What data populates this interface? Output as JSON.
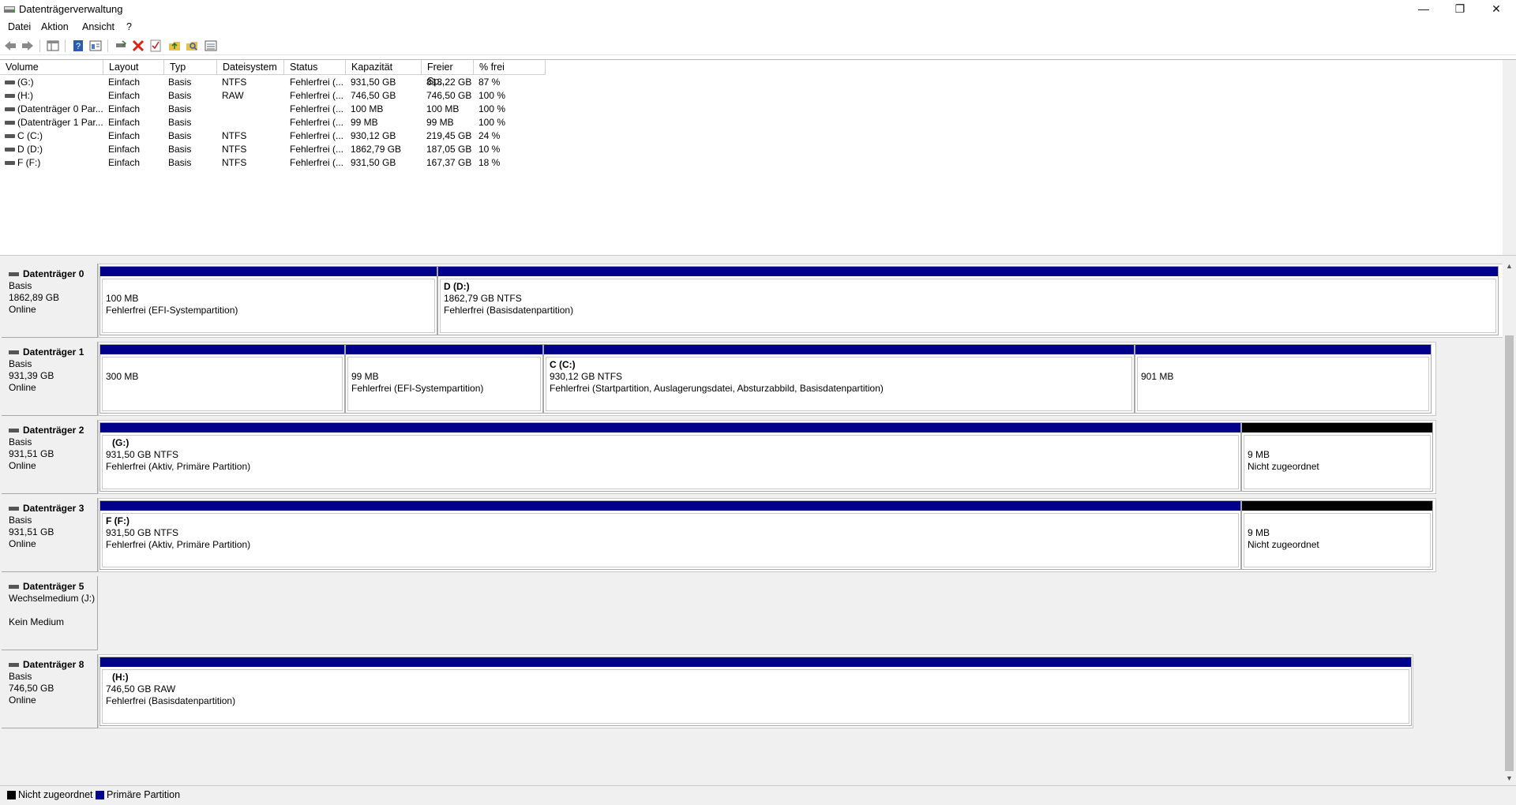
{
  "window": {
    "title": "Datenträgerverwaltung",
    "minimize": "—",
    "maximize": "❐",
    "close": "✕"
  },
  "menu": [
    "Datei",
    "Aktion",
    "Ansicht",
    "?"
  ],
  "toolbar": [
    "back-icon",
    "forward-icon",
    "console-tree-icon",
    "help-icon",
    "properties-icon",
    "connect-icon",
    "delete-icon",
    "check-icon",
    "import-icon",
    "search-icon",
    "list-icon"
  ],
  "columns": [
    "Volume",
    "Layout",
    "Typ",
    "Dateisystem",
    "Status",
    "Kapazität",
    "Freier Sp...",
    "% frei"
  ],
  "volumes": [
    {
      "volume": "(G:)",
      "layout": "Einfach",
      "typ": "Basis",
      "fs": "NTFS",
      "status": "Fehlerfrei (...",
      "cap": "931,50 GB",
      "free": "813,22 GB",
      "pct": "87 %"
    },
    {
      "volume": "(H:)",
      "layout": "Einfach",
      "typ": "Basis",
      "fs": "RAW",
      "status": "Fehlerfrei (...",
      "cap": "746,50 GB",
      "free": "746,50 GB",
      "pct": "100 %"
    },
    {
      "volume": "(Datenträger 0 Par...",
      "layout": "Einfach",
      "typ": "Basis",
      "fs": "",
      "status": "Fehlerfrei (...",
      "cap": "100 MB",
      "free": "100 MB",
      "pct": "100 %"
    },
    {
      "volume": "(Datenträger 1 Par...",
      "layout": "Einfach",
      "typ": "Basis",
      "fs": "",
      "status": "Fehlerfrei (...",
      "cap": "99 MB",
      "free": "99 MB",
      "pct": "100 %"
    },
    {
      "volume": "C (C:)",
      "layout": "Einfach",
      "typ": "Basis",
      "fs": "NTFS",
      "status": "Fehlerfrei (...",
      "cap": "930,12 GB",
      "free": "219,45 GB",
      "pct": "24 %"
    },
    {
      "volume": "D (D:)",
      "layout": "Einfach",
      "typ": "Basis",
      "fs": "NTFS",
      "status": "Fehlerfrei (...",
      "cap": "1862,79 GB",
      "free": "187,05 GB",
      "pct": "10 %"
    },
    {
      "volume": "F (F:)",
      "layout": "Einfach",
      "typ": "Basis",
      "fs": "NTFS",
      "status": "Fehlerfrei (...",
      "cap": "931,50 GB",
      "free": "167,37 GB",
      "pct": "18 %"
    }
  ],
  "disks": [
    {
      "name": "Datenträger 0",
      "l1": "Basis",
      "l2": "1862,89 GB",
      "l3": "Online",
      "parts": [
        {
          "name": "",
          "l1": "100 MB",
          "l2": "Fehlerfrei (EFI-Systempartition)",
          "bar": "blue"
        },
        {
          "name": "D  (D:)",
          "l1": "1862,79 GB NTFS",
          "l2": "Fehlerfrei (Basisdatenpartition)",
          "bar": "blue"
        }
      ]
    },
    {
      "name": "Datenträger 1",
      "l1": "Basis",
      "l2": "931,39 GB",
      "l3": "Online",
      "parts": [
        {
          "name": "",
          "l1": "300 MB",
          "l2": "",
          "bar": "blue"
        },
        {
          "name": "",
          "l1": "99 MB",
          "l2": "Fehlerfrei (EFI-Systempartition)",
          "bar": "blue"
        },
        {
          "name": "C  (C:)",
          "l1": "930,12 GB NTFS",
          "l2": "Fehlerfrei (Startpartition, Auslagerungsdatei, Absturzabbild, Basisdatenpartition)",
          "bar": "blue"
        },
        {
          "name": "",
          "l1": "901 MB",
          "l2": "",
          "bar": "blue"
        }
      ]
    },
    {
      "name": "Datenträger 2",
      "l1": "Basis",
      "l2": "931,51 GB",
      "l3": "Online",
      "parts": [
        {
          "name": "(G:)",
          "l1": "931,50 GB NTFS",
          "l2": "Fehlerfrei (Aktiv, Primäre Partition)",
          "bar": "blue"
        },
        {
          "name": "",
          "l1": "9 MB",
          "l2": "Nicht zugeordnet",
          "bar": "black"
        }
      ]
    },
    {
      "name": "Datenträger 3",
      "l1": "Basis",
      "l2": "931,51 GB",
      "l3": "Online",
      "parts": [
        {
          "name": "F  (F:)",
          "l1": "931,50 GB NTFS",
          "l2": "Fehlerfrei (Aktiv, Primäre Partition)",
          "bar": "blue"
        },
        {
          "name": "",
          "l1": "9 MB",
          "l2": "Nicht zugeordnet",
          "bar": "black"
        }
      ]
    },
    {
      "name": "Datenträger 5",
      "l1": "Wechselmedium (J:)",
      "l2": "",
      "l3": "Kein Medium",
      "parts": []
    },
    {
      "name": "Datenträger 8",
      "l1": "Basis",
      "l2": "746,50 GB",
      "l3": "Online",
      "parts": [
        {
          "name": "(H:)",
          "l1": "746,50 GB RAW",
          "l2": "Fehlerfrei (Basisdatenpartition)",
          "bar": "blue"
        }
      ]
    }
  ],
  "legend": [
    {
      "label": "Nicht zugeordnet",
      "color": "#000000"
    },
    {
      "label": "Primäre Partition",
      "color": "#00008b"
    }
  ]
}
